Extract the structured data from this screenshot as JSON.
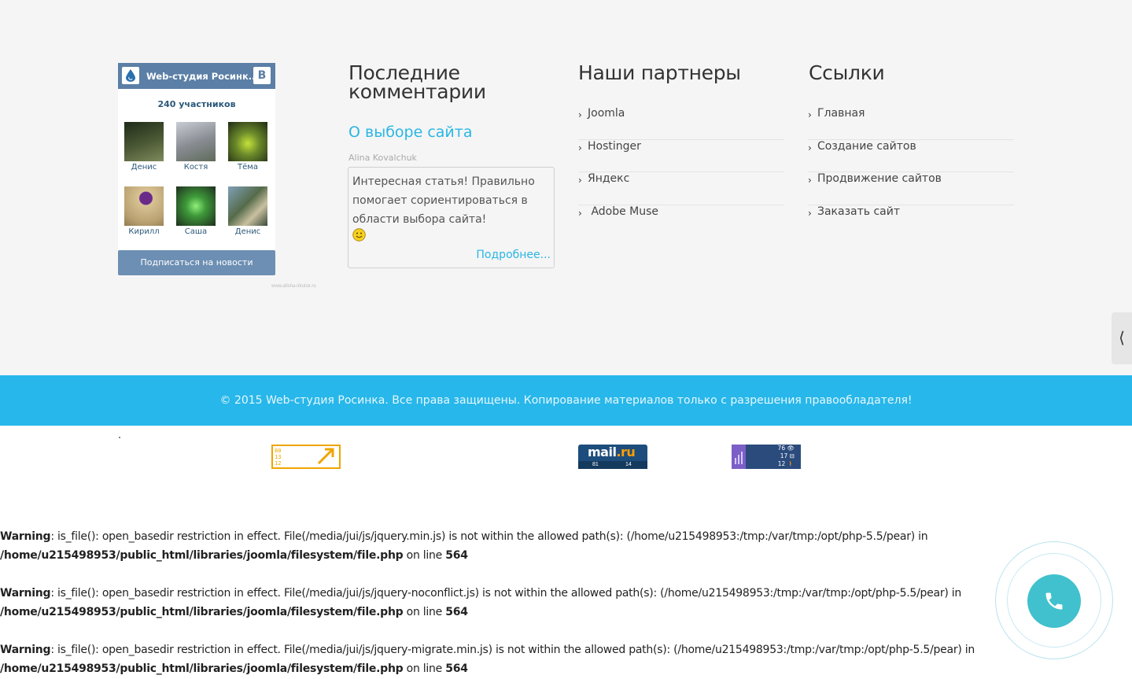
{
  "vk_widget": {
    "title": "Web-студия Росинк...",
    "logo_letter": "B",
    "members_count": "240 участников",
    "members": [
      {
        "name": "Денис",
        "color": "#3d4a2e"
      },
      {
        "name": "Костя",
        "color": "#8a8e95"
      },
      {
        "name": "Тёма",
        "color": "#6c8a2a"
      },
      {
        "name": "Кирилл",
        "color": "#b9a070"
      },
      {
        "name": "Саша",
        "color": "#3f6b3a"
      },
      {
        "name": "Денис",
        "color": "#556b4a"
      }
    ],
    "subscribe_label": "Подписаться на новости",
    "watermark": "www.afisha-irkutsk.ru"
  },
  "comments": {
    "title": "Последние комментарии",
    "title_line1": "Последние",
    "title_line2": "комментарии",
    "post_link": "О выборе сайта",
    "author": "Alina Kovalchuk",
    "text": "Интересная статья! Правильно помогает сориентироваться в области выбора сайта!",
    "more_label": "Подробнее..."
  },
  "partners": {
    "title": "Наши партнеры",
    "items": [
      "Joomla",
      "Hostinger",
      "Яндекс",
      " Adobe Muse"
    ]
  },
  "links": {
    "title": "Ссылки",
    "items": [
      "Главная",
      "Создание сайтов",
      "Продвижение сайтов",
      "Заказать сайт"
    ]
  },
  "side_tab_glyph": "⟨",
  "copyright": "© 2015 Web-студия Росинка. Все права защищены. Копирование материалов только с разрешения правообладателя!",
  "counters": {
    "mail_brand": "mail",
    "mail_tld": ".ru",
    "mail_n1": "81",
    "mail_n2": "14",
    "ya_rows": [
      "76 👁",
      "17 ⊟",
      "12 🚶"
    ]
  },
  "warnings": [
    {
      "label": "Warning",
      "msg": ": is_file(): open_basedir restriction in effect. File(/media/jui/js/jquery.min.js) is not within the allowed path(s): (/home/u215498953:/tmp:/var/tmp:/opt/php-5.5/pear) in ",
      "path": "/home/u215498953/public_html/libraries/joomla/filesystem/file.php",
      "online": " on line ",
      "line": "564"
    },
    {
      "label": "Warning",
      "msg": ": is_file(): open_basedir restriction in effect. File(/media/jui/js/jquery-noconflict.js) is not within the allowed path(s): (/home/u215498953:/tmp:/var/tmp:/opt/php-5.5/pear) in ",
      "path": "/home/u215498953/public_html/libraries/joomla/filesystem/file.php",
      "online": " on line ",
      "line": "564"
    },
    {
      "label": "Warning",
      "msg": ": is_file(): open_basedir restriction in effect. File(/media/jui/js/jquery-migrate.min.js) is not within the allowed path(s): (/home/u215498953:/tmp:/var/tmp:/opt/php-5.5/pear) in ",
      "path": "/home/u215498953/public_html/libraries/joomla/filesystem/file.php",
      "online": " on line ",
      "line": "564"
    }
  ],
  "colors": {
    "accent": "#27b7ea",
    "link": "#2ab6e5",
    "vk_header": "#5b7fa6",
    "call_button": "#20b6c4"
  }
}
